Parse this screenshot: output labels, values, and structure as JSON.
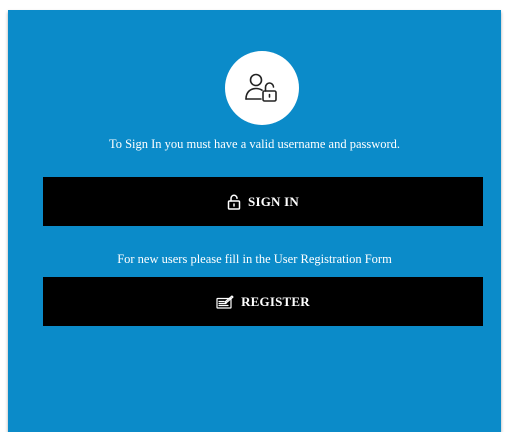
{
  "signin_hint": "To Sign In you must have a valid username and password.",
  "signin_button": {
    "label": "SIGN IN",
    "icon": "unlock-icon"
  },
  "register_hint": "For new users please fill in the User Registration Form",
  "register_button": {
    "label": "REGISTER",
    "icon": "form-icon"
  },
  "avatar": {
    "icon": "user-unlock-icon"
  },
  "colors": {
    "panel_background": "#0b8bc9",
    "button_background": "#000000",
    "button_text": "#ffffff",
    "avatar_background": "#ffffff"
  }
}
